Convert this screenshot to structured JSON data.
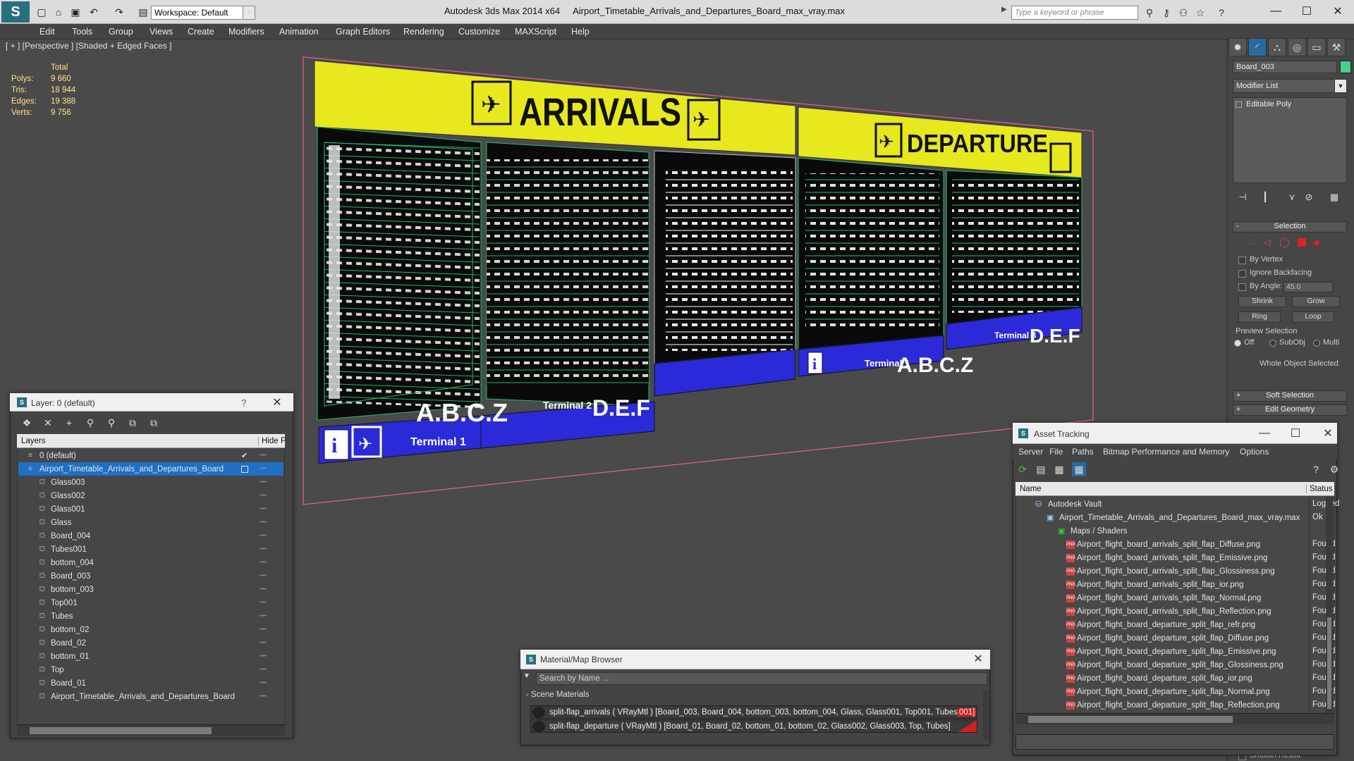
{
  "titlebar": {
    "app": "Autodesk 3ds Max  2014 x64",
    "file": "Airport_Timetable_Arrivals_and_Departures_Board_max_vray.max",
    "workspace": "Workspace: Default",
    "search_placeholder": "Type a keyword or phrase"
  },
  "menu": [
    "Edit",
    "Tools",
    "Group",
    "Views",
    "Create",
    "Modifiers",
    "Animation",
    "Graph Editors",
    "Rendering",
    "Customize",
    "MAXScript",
    "Help"
  ],
  "viewport": {
    "label": "[ + ] [Perspective ] [Shaded + Edged Faces ]",
    "stats_header": "Total",
    "stats": [
      {
        "label": "Polys:",
        "value": "9 660"
      },
      {
        "label": "Tris:",
        "value": "18 944"
      },
      {
        "label": "Edges:",
        "value": "19 388"
      },
      {
        "label": "Verts:",
        "value": "9 756"
      }
    ],
    "board": {
      "arrivals": "ARRIVALS",
      "departure": "DEPARTURE",
      "terminal1a": "Terminal 1",
      "abcz_a": "A.B.C.Z",
      "terminal2": "Terminal 2",
      "def_a": "D.E.F",
      "terminal1b": "Terminal 1",
      "abcz_b": "A.B.C.Z",
      "terminal3": "Terminal 3",
      "def_b": "D.E.F"
    }
  },
  "command_panel": {
    "object_name": "Board_003",
    "object_color": "#46d28c",
    "modifier_list": "Modifier List",
    "stack_item": "Editable Poly",
    "selection_title": "Selection",
    "by_vertex": "By Vertex",
    "ignore_backfacing": "Ignore Backfacing",
    "by_angle": "By Angle:",
    "angle_value": "45.0",
    "shrink": "Shrink",
    "grow": "Grow",
    "ring": "Ring",
    "loop": "Loop",
    "preview_selection": "Preview Selection",
    "off": "Off",
    "subobj": "SubObj",
    "multi": "Multi",
    "whole_object": "Whole Object Selected",
    "soft_selection": "Soft Selection",
    "edit_geometry": "Edit Geometry",
    "smooth_result": "Smooth Result"
  },
  "layer_panel": {
    "title": "Layer: 0 (default)",
    "help": "?",
    "col_layers": "Layers",
    "col_hide": "Hide",
    "col_f": "F",
    "rows": [
      {
        "name": "0 (default)",
        "indent": 1,
        "check": true
      },
      {
        "name": "Airport_Timetable_Arrivals_and_Departures_Board",
        "indent": 1,
        "selected": true
      },
      {
        "name": "Glass003",
        "indent": 2
      },
      {
        "name": "Glass002",
        "indent": 2
      },
      {
        "name": "Glass001",
        "indent": 2
      },
      {
        "name": "Glass",
        "indent": 2
      },
      {
        "name": "Board_004",
        "indent": 2
      },
      {
        "name": "Tubes001",
        "indent": 2
      },
      {
        "name": "bottom_004",
        "indent": 2
      },
      {
        "name": "Board_003",
        "indent": 2
      },
      {
        "name": "bottom_003",
        "indent": 2
      },
      {
        "name": "Top001",
        "indent": 2
      },
      {
        "name": "Tubes",
        "indent": 2
      },
      {
        "name": "bottom_02",
        "indent": 2
      },
      {
        "name": "Board_02",
        "indent": 2
      },
      {
        "name": "bottom_01",
        "indent": 2
      },
      {
        "name": "Top",
        "indent": 2
      },
      {
        "name": "Board_01",
        "indent": 2
      },
      {
        "name": "Airport_Timetable_Arrivals_and_Departures_Board",
        "indent": 2
      }
    ]
  },
  "asset_tracking": {
    "title": "Asset Tracking",
    "menu": [
      "Server",
      "File",
      "Paths",
      "Bitmap Performance and Memory",
      "Options"
    ],
    "col_name": "Name",
    "col_status": "Status",
    "rows": [
      {
        "name": "Autodesk Vault",
        "status": "Logged",
        "level": 0,
        "icon": "vault"
      },
      {
        "name": "Airport_Timetable_Arrivals_and_Departures_Board_max_vray.max",
        "status": "Ok",
        "level": 1,
        "icon": "max"
      },
      {
        "name": "Maps / Shaders",
        "status": "",
        "level": 2,
        "icon": "maps"
      },
      {
        "name": "Airport_flight_board_arrivals_split_flap_Diffuse.png",
        "status": "Found",
        "level": 3,
        "icon": "png"
      },
      {
        "name": "Airport_flight_board_arrivals_split_flap_Emissive.png",
        "status": "Found",
        "level": 3,
        "icon": "png"
      },
      {
        "name": "Airport_flight_board_arrivals_split_flap_Glossiness.png",
        "status": "Found",
        "level": 3,
        "icon": "png"
      },
      {
        "name": "Airport_flight_board_arrivals_split_flap_ior.png",
        "status": "Found",
        "level": 3,
        "icon": "png"
      },
      {
        "name": "Airport_flight_board_arrivals_split_flap_Normal.png",
        "status": "Found",
        "level": 3,
        "icon": "png"
      },
      {
        "name": "Airport_flight_board_arrivals_split_flap_Reflection.png",
        "status": "Found",
        "level": 3,
        "icon": "png"
      },
      {
        "name": "Airport_flight_board_departure_split_flap_refr.png",
        "status": "Found",
        "level": 3,
        "icon": "png"
      },
      {
        "name": "Airport_flight_board_departure_split_flap_Diffuse.png",
        "status": "Found",
        "level": 3,
        "icon": "png"
      },
      {
        "name": "Airport_flight_board_departure_split_flap_Emissive.png",
        "status": "Found",
        "level": 3,
        "icon": "png"
      },
      {
        "name": "Airport_flight_board_departure_split_flap_Glossiness.png",
        "status": "Found",
        "level": 3,
        "icon": "png"
      },
      {
        "name": "Airport_flight_board_departure_split_flap_ior.png",
        "status": "Found",
        "level": 3,
        "icon": "png"
      },
      {
        "name": "Airport_flight_board_departure_split_flap_Normal.png",
        "status": "Found",
        "level": 3,
        "icon": "png"
      },
      {
        "name": "Airport_flight_board_departure_split_flap_Reflection.png",
        "status": "Found",
        "level": 3,
        "icon": "png"
      }
    ]
  },
  "material_browser": {
    "title": "Material/Map Browser",
    "search_placeholder": "Search by Name ...",
    "group": "Scene Materials",
    "items": [
      {
        "name": "split-flap_arrivals",
        "type": "( VRayMtl )",
        "objects_a": "[Board_003, Board_004, bottom_003, bottom_004, Glass, Glass001, Top001, Tubes",
        "objects_b": "001]"
      },
      {
        "name": "split-flap_departure",
        "type": "( VRayMtl )",
        "objects_a": "[Board_01, Board_02, bottom_01, bottom_02, Glass002, Glass003, Top, Tubes]",
        "objects_b": ""
      }
    ]
  }
}
